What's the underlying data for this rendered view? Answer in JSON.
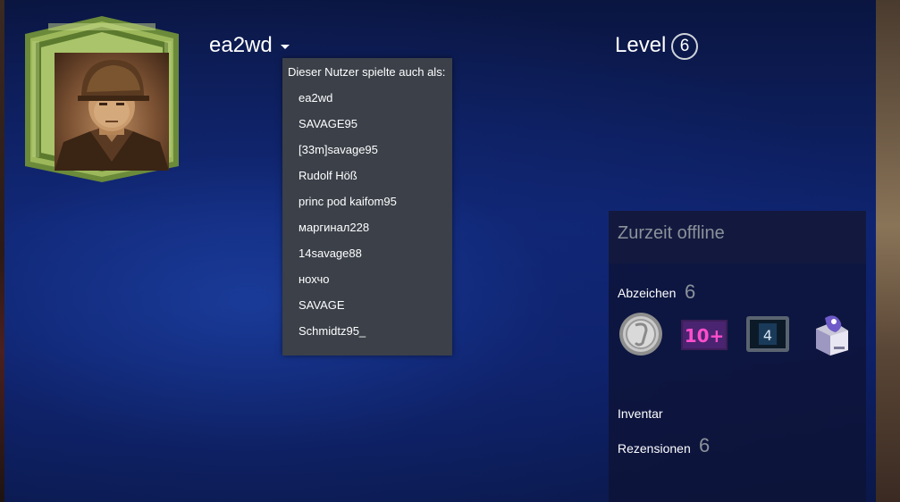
{
  "profile": {
    "persona_name": "ea2wd",
    "level_label": "Level",
    "level_value": "6"
  },
  "aliases": {
    "header": "Dieser Nutzer spielte auch als:",
    "items": [
      "ea2wd",
      "SAVAGE95",
      "[33m]savage95",
      "Rudolf Höß",
      "princ pod kaifom95",
      "маргинал228",
      "14savage88",
      "нохчо",
      "SAVAGE",
      "Schmidtz95_"
    ]
  },
  "side_panel": {
    "status": "Zurzeit offline",
    "badges_label": "Abzeichen",
    "badges_count": "6",
    "badges": [
      {
        "icon": "silver-coin-icon"
      },
      {
        "icon": "ten-plus-icon",
        "text": "10+"
      },
      {
        "icon": "monitor-four-icon",
        "text": "4"
      },
      {
        "icon": "cube-trading-card-icon"
      }
    ],
    "inventory_label": "Inventar",
    "reviews_label": "Rezensionen",
    "reviews_count": "6"
  },
  "colors": {
    "popup_bg": "#3b4049",
    "muted_text": "#8b929a",
    "frame_green": "#8ba44a"
  }
}
